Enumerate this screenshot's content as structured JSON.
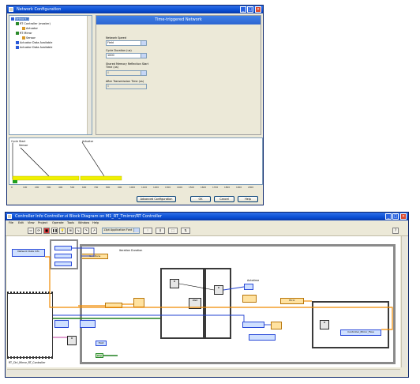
{
  "top_window": {
    "title": "Network Configuration",
    "tree": {
      "items": [
        {
          "label": "Network 1"
        },
        {
          "label": "RT Controller (master)"
        },
        {
          "label": "Actuator"
        },
        {
          "label": "RT Mirror"
        },
        {
          "label": "Sensor"
        },
        {
          "label": "Actuator Data Available"
        },
        {
          "label": "Actuator Data Available"
        }
      ]
    },
    "panel": {
      "header": "Time-triggered Network",
      "network_speed_label": "Network Speed",
      "network_speed_value": "Field",
      "cycle_duration_label": "Cycle Duration (us)",
      "cycle_duration_value": "1000",
      "shared_memory_label": "Shared Memory Reflection Start Time (us)",
      "shared_memory_value": "0",
      "after_transmission_label": "After Transmission Time (us)",
      "after_transmission_value": "0"
    },
    "timeline": {
      "cycle_label": "Cycle Start",
      "sensor_label": "Sensor",
      "actuator_label": "Actuator",
      "ticks": [
        "0",
        "100",
        "200",
        "300",
        "400",
        "500",
        "600",
        "700",
        "800",
        "900",
        "1000",
        "1100",
        "1200",
        "1300",
        "1400",
        "1500",
        "1600",
        "1700",
        "1800",
        "1900",
        "2000"
      ]
    },
    "buttons": {
      "advanced": "Advanced Configuration",
      "ok": "OK",
      "cancel": "Cancel",
      "help": "Help"
    },
    "colors": {
      "title_bar": "#0a4fd4",
      "timeline_bar": "#f0f000",
      "panel_header": "#3e7fe8"
    }
  },
  "bottom_window": {
    "title": "Controller Info Controller.vi Block Diagram on M1_RT_Tmirror/RT Controller",
    "menu": [
      "File",
      "Edit",
      "View",
      "Project",
      "Operate",
      "Tools",
      "Window",
      "Help"
    ],
    "toolbar": {
      "font_select": "13pt Application Font"
    },
    "diagram": {
      "network_data_label": "Network Data Info",
      "iteration_duration_label": "Iteration Duration",
      "iteration_value": "Iterations",
      "hold_label": "Hold",
      "error_label": "Error",
      "stop_label": "stop",
      "autotime_label": "Autotime",
      "controller_label": "Controller_Mirror_Flow",
      "scan_label": "RT_Ctrl_Mirror_RT_Controller"
    },
    "colors": {
      "wire_orange": "#f08a00",
      "wire_blue": "#2040d0",
      "wire_green": "#208020",
      "frame_gray": "#8a8a8a"
    }
  }
}
